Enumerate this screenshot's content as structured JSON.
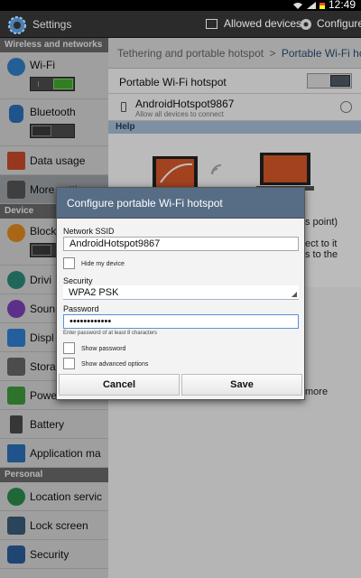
{
  "status_bar": {
    "time": "12:49"
  },
  "action_bar": {
    "title": "Settings",
    "allowed_devices_label": "Allowed devices",
    "configure_label": "Configure"
  },
  "left_pane": {
    "sections": [
      {
        "header": "Wireless and networks",
        "items": [
          {
            "label": "Wi-Fi",
            "icon": "wifi-icon",
            "toggle": "on"
          },
          {
            "label": "Bluetooth",
            "icon": "bluetooth-icon",
            "toggle": "off"
          },
          {
            "label": "Data usage",
            "icon": "data-usage-icon"
          },
          {
            "label": "More settings",
            "icon": "more-icon",
            "selected": true
          }
        ]
      },
      {
        "header": "Device",
        "items": [
          {
            "label": "Block",
            "icon": "block-icon",
            "toggle": "off"
          },
          {
            "label": "Drivi",
            "icon": "driving-icon"
          },
          {
            "label": "Soun",
            "icon": "sound-icon"
          },
          {
            "label": "Displ",
            "icon": "display-icon"
          },
          {
            "label": "Stora",
            "icon": "storage-icon"
          },
          {
            "label": "Powe",
            "icon": "power-icon"
          },
          {
            "label": "Battery",
            "icon": "battery-icon"
          },
          {
            "label": "Application ma",
            "icon": "apps-icon"
          }
        ]
      },
      {
        "header": "Personal",
        "items": [
          {
            "label": "Location servic",
            "icon": "location-icon"
          },
          {
            "label": "Lock screen",
            "icon": "lock-icon"
          },
          {
            "label": "Security",
            "icon": "security-icon"
          }
        ]
      }
    ]
  },
  "right_pane": {
    "breadcrumb_parent": "Tethering and portable hotspot",
    "breadcrumb_sep": ">",
    "breadcrumb_current": "Portable Wi-Fi ho",
    "portable_hotspot_label": "Portable Wi-Fi hotspot",
    "hotspot_ssid": "AndroidHotspot9867",
    "hotspot_sub": "Allow all devices to connect",
    "help_header": "Help",
    "help_fragments": [
      "s point)",
      "ect to it",
      "s to the",
      "more"
    ]
  },
  "dialog": {
    "title": "Configure portable Wi-Fi hotspot",
    "ssid_label": "Network SSID",
    "ssid_value": "AndroidHotspot9867",
    "hide_device_label": "Hide my device",
    "security_label": "Security",
    "security_value": "WPA2 PSK",
    "password_label": "Password",
    "password_value": "••••••••••••",
    "password_hint": "Enter password of at least 8 characters",
    "show_password_label": "Show password",
    "show_advanced_label": "Show advanced options",
    "cancel_label": "Cancel",
    "save_label": "Save"
  },
  "colors": {
    "action_bar": "#2b2b2b",
    "dialog_title": "#576c85",
    "toggle_on": "#45a82f",
    "help_header": "#a8c0d8"
  }
}
